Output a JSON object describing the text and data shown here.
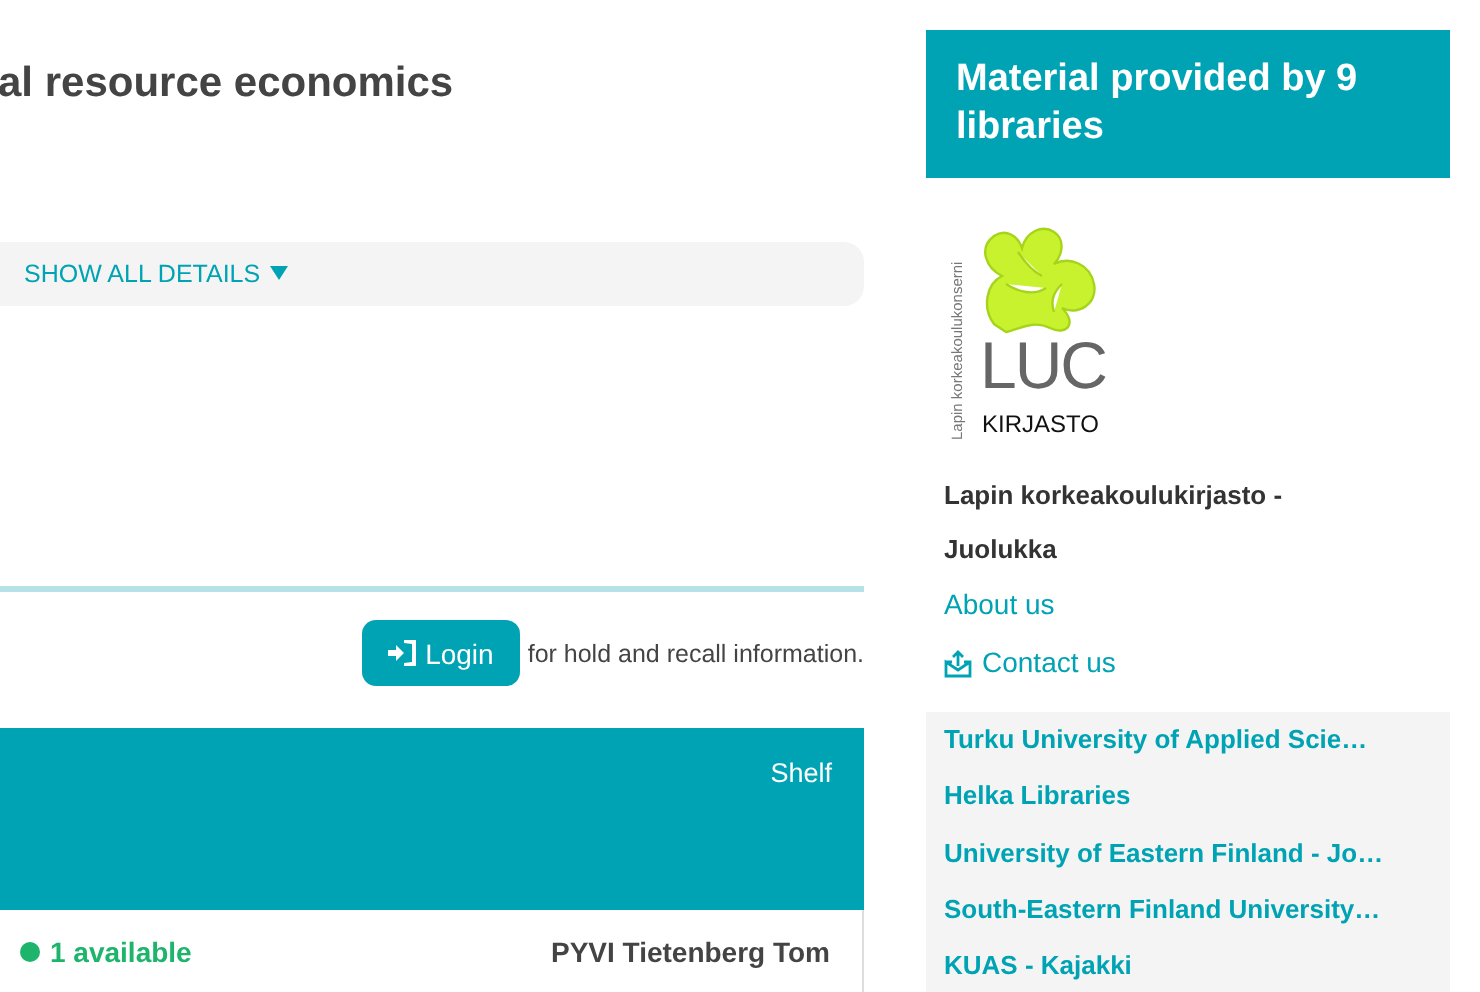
{
  "record": {
    "title": "al resource economics",
    "details_toggle": "SHOW ALL DETAILS",
    "login_button": "Login",
    "login_note": "for hold and recall information.",
    "holdings": {
      "columns": [
        "Shelf"
      ],
      "rows": [
        {
          "status": "1 available",
          "color": "#1db46c",
          "shelf": "PYVI Tietenberg Tom"
        }
      ]
    }
  },
  "sidebar": {
    "heading": "Material provided by 9 libraries",
    "logo": {
      "side_text": "Lapin korkeakoulukonserni",
      "name": "LUC",
      "subtitle": "KIRJASTO"
    },
    "library_name": "Lapin korkeakoulukirjasto - Juolukka",
    "links": [
      {
        "label": "About us",
        "kind": "plain"
      },
      {
        "label": "Contact us",
        "kind": "contact"
      }
    ],
    "libraries": [
      "Turku University of Applied Scie…",
      "Helka Libraries",
      "University of Eastern Finland - Jo…",
      "South-Eastern Finland University…",
      "KUAS - Kajakki"
    ]
  }
}
